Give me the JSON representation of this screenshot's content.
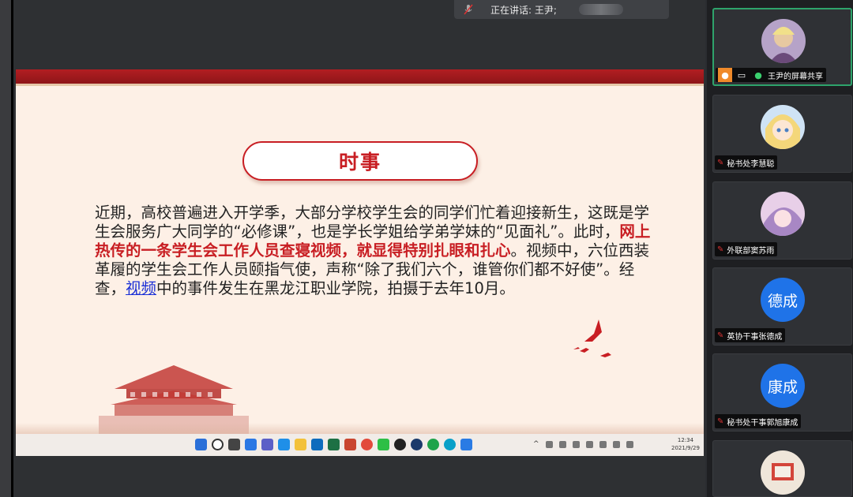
{
  "speaking": {
    "label": "正在讲话: 王尹;"
  },
  "slide": {
    "title": "时事",
    "para": {
      "p1": "近期，高校普遍进入开学季，大部分学校学生会的同学们忙着迎接新生，这既是学生会服务广大同学的“必修课”，也是学长学姐给学弟学妹的“见面礼”。此时，",
      "highlight": "网上热传的一条学生会工作人员查寝视频，就显得特别扎眼和扎心",
      "p2": "。视频中，六位西装革履的学生会工作人员颐指气使，声称“除了我们六个，谁管你们都不好使”。经查，",
      "link": "视频",
      "p3": "中的事件发生在黑龙江职业学院，拍摄于去年10月。"
    }
  },
  "taskbar": {
    "clock_time": "12:34",
    "clock_date": "2021/9/29"
  },
  "participants": [
    {
      "name": "王尹的屏幕共享",
      "avatar_kind": "image",
      "active": true
    },
    {
      "name": "秘书处李慧聪",
      "avatar_kind": "image",
      "active": false
    },
    {
      "name": "外联部窦苏雨",
      "avatar_kind": "image",
      "active": false
    },
    {
      "name": "英协干事张德成",
      "avatar_text": "德成",
      "avatar_kind": "text",
      "active": false
    },
    {
      "name": "秘书处干事郭旭康成",
      "avatar_text": "康成",
      "avatar_kind": "text",
      "active": false
    },
    {
      "name": "",
      "avatar_kind": "image",
      "active": false
    }
  ],
  "colors": {
    "accent_red": "#c81e23",
    "avatar_blue": "#1f73e8",
    "active_border": "#2ea36b"
  }
}
